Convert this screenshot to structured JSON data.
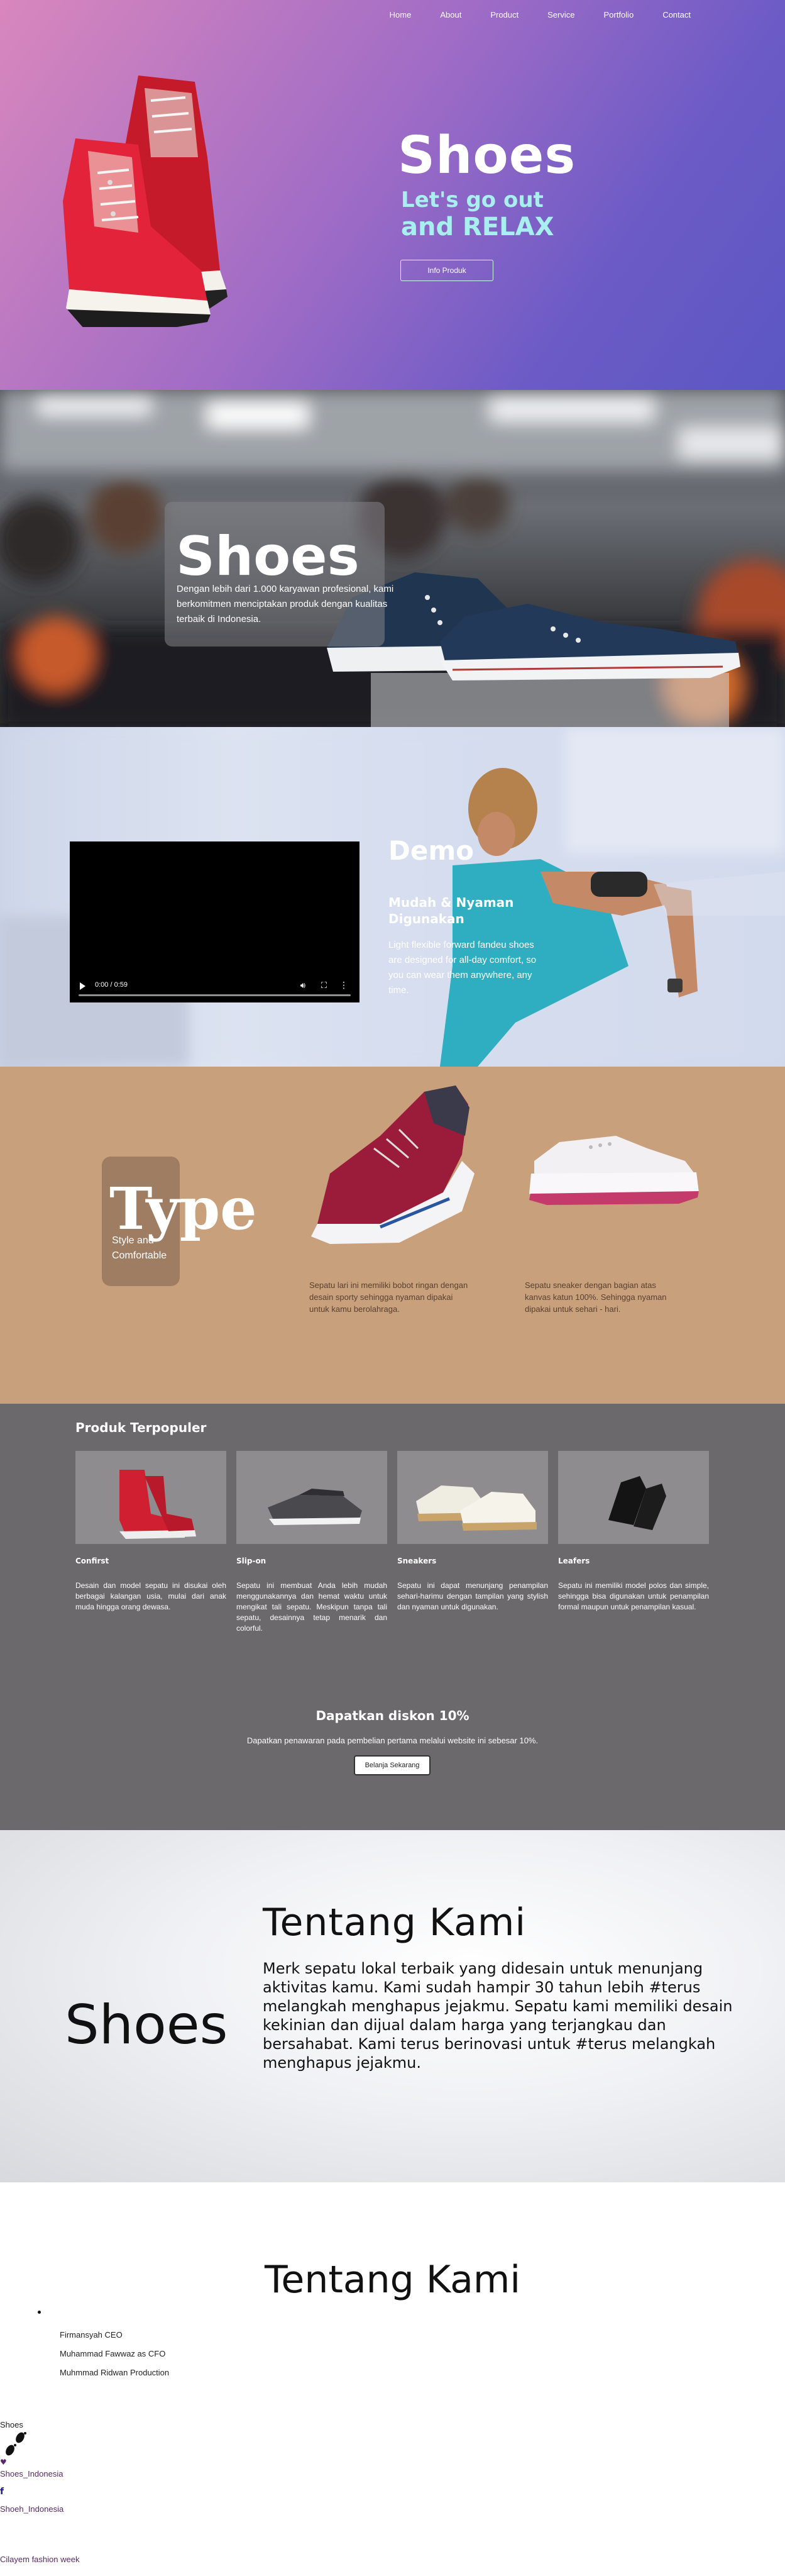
{
  "nav": {
    "items": [
      "Home",
      "About",
      "Product",
      "Service",
      "Portfolio",
      "Contact"
    ]
  },
  "hero1": {
    "title": "Shoes",
    "subtitle_line1": "Let's go out",
    "subtitle_line2": "and RELAX",
    "button": "Info Produk",
    "gradient_colors": [
      "#d987bd",
      "#a06cc6",
      "#5b57c3"
    ]
  },
  "hero2": {
    "title": "Shoes",
    "description": "Dengan lebih dari 1.000 karyawan profesional, kami berkomitmen menciptakan produk dengan kualitas terbaik di Indonesia."
  },
  "hero3": {
    "title": "Demo",
    "tagline": "Mudah & Nyaman Digunakan",
    "description": "Light flexible forward fandeu shoes are designed for all-day comfort, so you can wear them anywhere, any time.",
    "video_time": "0:00 / 0:59"
  },
  "type_section": {
    "title": "Type",
    "tagline": "Style and Comfortable",
    "desc_a": "Sepatu lari ini memiliki bobot ringan dengan desain sporty sehingga nyaman dipakai untuk kamu berolahraga.",
    "desc_b": "Sepatu sneaker dengan bagian atas kanvas katun 100%. Sehingga nyaman dipakai untuk sehari - hari.",
    "background": "#c8a07b"
  },
  "popular": {
    "heading": "Produk Terpopuler",
    "products": [
      {
        "name": "Confirst",
        "text": "Desain dan model sepatu ini disukai oleh berbagai kalangan usia, mulai dari anak muda hingga orang dewasa.",
        "icon": "red-highcut-sneaker"
      },
      {
        "name": "Slip-on",
        "text": "Sepatu ini membuat Anda lebih mudah menggunakannya dan hemat waktu untuk mengikat tali sepatu. Meskipun tanpa tali sepatu, desainnya tetap menarik dan colorful.",
        "icon": "grey-slipon-shoe"
      },
      {
        "name": "Sneakers",
        "text": "Sepatu ini dapat menunjang penampilan sehari-harimu dengan tampilan yang stylish dan nyaman untuk digunakan.",
        "icon": "white-sneaker-pair"
      },
      {
        "name": "Leafers",
        "text": "Sepatu ini memiliki model polos dan simple, sehingga bisa digunakan untuk penampilan formal maupun untuk penampilan kasual.",
        "icon": "black-loafer-pair"
      }
    ],
    "discount_title": "Dapatkan diskon 10%",
    "discount_text": "Dapatkan penawaran pada pembelian pertama melalui website ini sebesar 10%.",
    "discount_button": "Belanja Sekarang"
  },
  "about1": {
    "brand": "Shoes",
    "title": "Tentang Kami",
    "text": "Merk sepatu lokal terbaik yang didesain untuk menunjang aktivitas kamu. Kami sudah hampir 30 tahun lebih #terus melangkah menghapus jejakmu. Sepatu kami memiliki desain kekinian dan dijual dalam harga yang terjangkau dan bersahabat. Kami terus berinovasi untuk #terus melangkah menghapus jejakmu."
  },
  "about2": {
    "title": "Tentang Kami",
    "team": [
      "Firmansyah CEO",
      "Muhammad Fawwaz as CFO",
      "Muhmmad Ridwan Production"
    ],
    "footer_brand": "Shoes",
    "heart_icon": "♥",
    "instagram": "Shoes_Indonesia",
    "facebook_icon": "f",
    "facebook": "Shoeh_Indonesia",
    "twitter": "Cilayem fashion week"
  }
}
